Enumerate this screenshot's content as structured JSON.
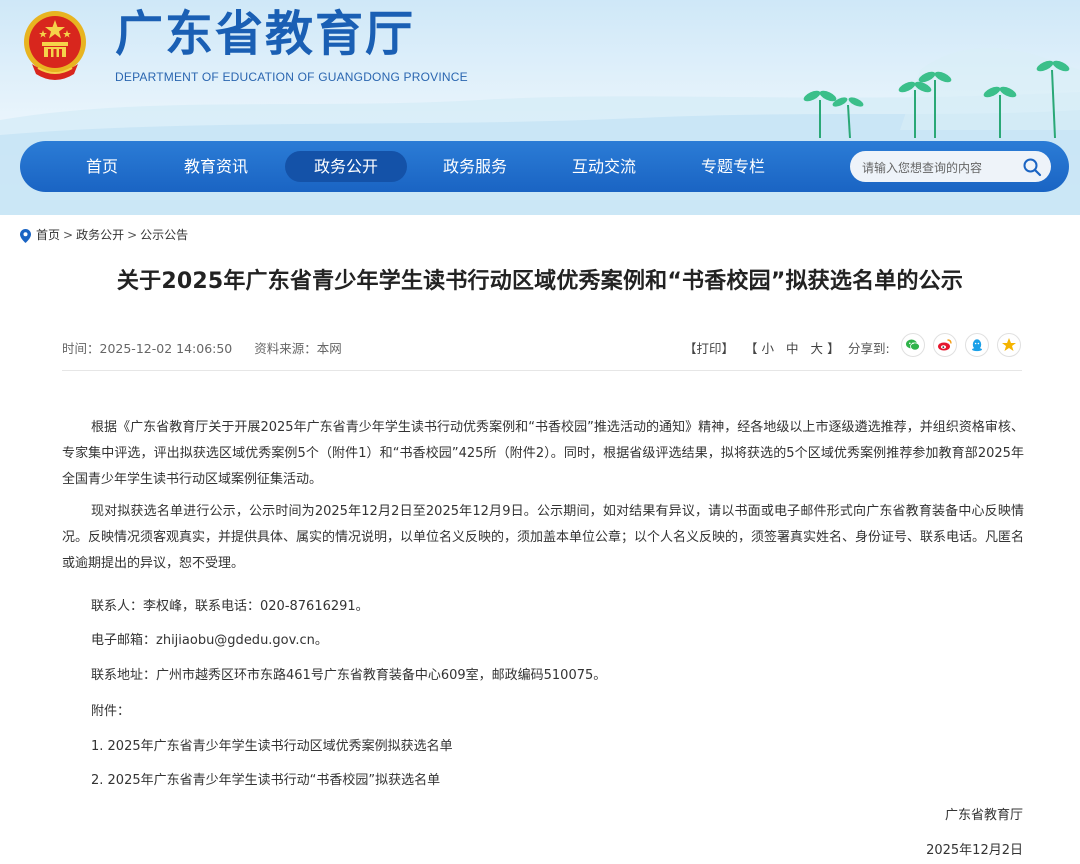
{
  "header": {
    "title": "广东省教育厅",
    "subtitle": "DEPARTMENT OF EDUCATION OF GUANGDONG PROVINCE"
  },
  "nav": {
    "items": [
      {
        "label": "首页"
      },
      {
        "label": "教育资讯"
      },
      {
        "label": "政务公开",
        "active": true
      },
      {
        "label": "政务服务"
      },
      {
        "label": "互动交流"
      },
      {
        "label": "专题专栏"
      }
    ],
    "search_placeholder": "请输入您想查询的内容"
  },
  "breadcrumb": {
    "items": [
      "首页",
      "政务公开",
      "公示公告"
    ],
    "separator": ">"
  },
  "article": {
    "title": "关于2025年广东省青少年学生读书行动区域优秀案例和“书香校园”拟获选名单的公示",
    "time": "时间：2025-12-02 14:06:50",
    "source": "资料来源：本网",
    "print_label": "【打印】",
    "font_open": "【",
    "font_small": "小",
    "font_medium": "中",
    "font_large": "大",
    "font_close": "】",
    "share_label": "分享到:",
    "share_icons": [
      "wechat-icon",
      "weibo-icon",
      "qq-icon",
      "qzone-icon"
    ],
    "paragraphs": [
      "根据《广东省教育厅关于开展2025年广东省青少年学生读书行动优秀案例和“书香校园”推选活动的通知》精神，经各地级以上市逐级遴选推荐，并组织资格审核、专家集中评选，评出拟获选区域优秀案例5个（附件1）和“书香校园”425所（附件2）。同时，根据省级评选结果，拟将获选的5个区域优秀案例推荐参加教育部2025年全国青少年学生读书行动区域案例征集活动。",
      "现对拟获选名单进行公示，公示时间为2025年12月2日至2025年12月9日。公示期间，如对结果有异议，请以书面或电子邮件形式向广东省教育装备中心反映情况。反映情况须客观真实，并提供具体、属实的情况说明，以单位名义反映的，须加盖本单位公章；以个人名义反映的，须签署真实姓名、身份证号、联系电话。凡匿名或逾期提出的异议，恕不受理。"
    ],
    "contact": "联系人：李权峰，联系电话：020-87616291。",
    "email": "电子邮箱：zhijiaobu@gdedu.gov.cn。",
    "address": "联系地址：广州市越秀区环市东路461号广东省教育装备中心609室，邮政编码510075。",
    "attachments_label": "附件：",
    "attachment_1": "1. 2025年广东省青少年学生读书行动区域优秀案例拟获选名单",
    "attachment_2": "2. 2025年广东省青少年学生读书行动“书香校园”拟获选名单",
    "signature": "广东省教育厅",
    "date": "2025年12月2日"
  },
  "colors": {
    "brand_blue": "#1a5fb4",
    "nav_blue": "#1a64c3",
    "nav_active": "#1452a8"
  }
}
